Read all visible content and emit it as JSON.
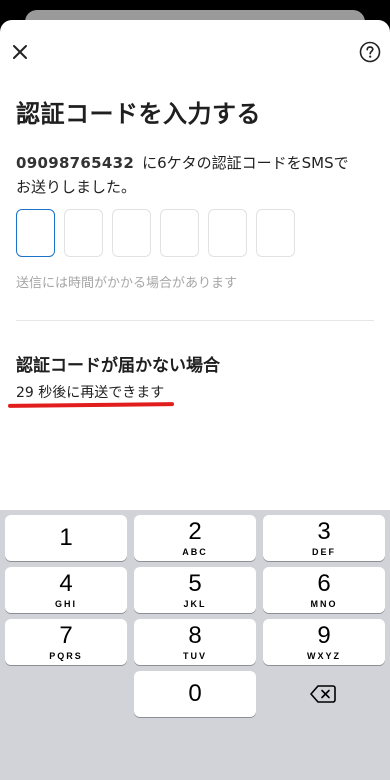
{
  "header": {
    "close_icon": "close-icon",
    "help_icon": "help-icon"
  },
  "title": "認証コードを入力する",
  "description": {
    "phone": "09098765432",
    "line1_rest": "に6ケタの認証コードをSMSで",
    "line2": "お送りしました。"
  },
  "code_input": {
    "length": 6,
    "active_index": 0
  },
  "hint": "送信には時間がかかる場合があります",
  "not_received": {
    "heading": "認証コードが届かない場合",
    "countdown": "29 秒後に再送できます"
  },
  "colors": {
    "active_border": "#1a73c9",
    "underline": "#e21d1d",
    "keyboard_bg": "#d2d3d8"
  },
  "keypad": {
    "keys": [
      {
        "digit": "1",
        "letters": ""
      },
      {
        "digit": "2",
        "letters": "ABC"
      },
      {
        "digit": "3",
        "letters": "DEF"
      },
      {
        "digit": "4",
        "letters": "GHI"
      },
      {
        "digit": "5",
        "letters": "JKL"
      },
      {
        "digit": "6",
        "letters": "MNO"
      },
      {
        "digit": "7",
        "letters": "PQRS"
      },
      {
        "digit": "8",
        "letters": "TUV"
      },
      {
        "digit": "9",
        "letters": "WXYZ"
      },
      {
        "digit": "0",
        "letters": ""
      }
    ],
    "delete_icon": "backspace-icon"
  }
}
